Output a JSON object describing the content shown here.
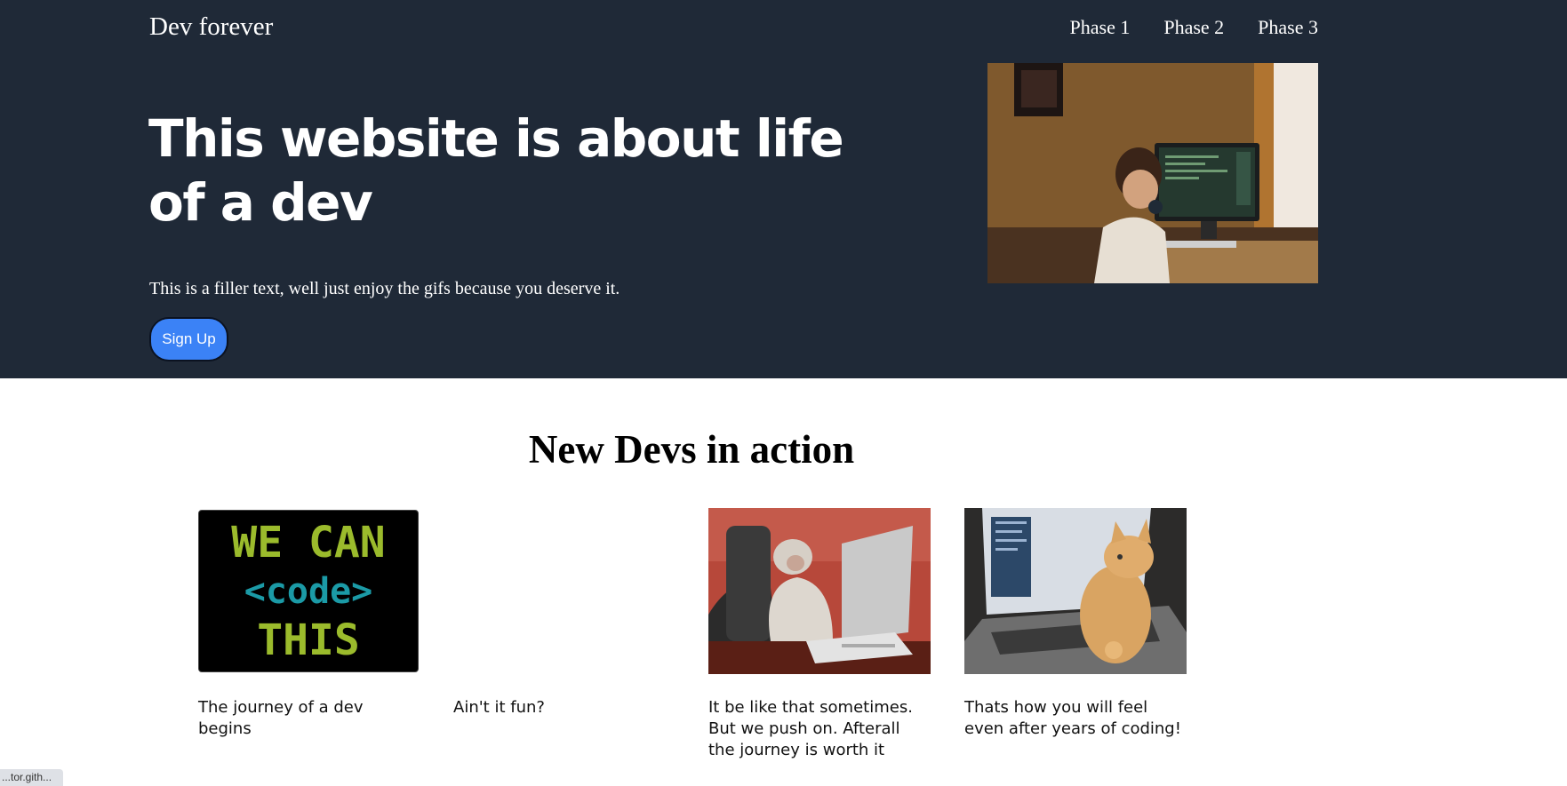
{
  "header": {
    "brand": "Dev forever",
    "nav": [
      "Phase 1",
      "Phase 2",
      "Phase 3"
    ]
  },
  "hero": {
    "title": "This website is about life of a dev",
    "text": "This is a filler text, well just enjoy the gifs because you deserve it.",
    "cta": "Sign Up"
  },
  "section": {
    "title": "New Devs in action",
    "cards": [
      {
        "caption": "The journey of a dev begins",
        "gif_lines": [
          "WE CAN",
          "<code>",
          "THIS"
        ]
      },
      {
        "caption": "Ain't it fun?"
      },
      {
        "caption": "It be like that sometimes. But we push on. Afterall the journey is worth it"
      },
      {
        "caption": "Thats how you will feel even after years of coding!"
      }
    ]
  },
  "status_bar": {
    "url": "...tor.gith..."
  },
  "colors": {
    "hero_bg": "#1f2937",
    "cta_bg": "#3b82f6"
  }
}
